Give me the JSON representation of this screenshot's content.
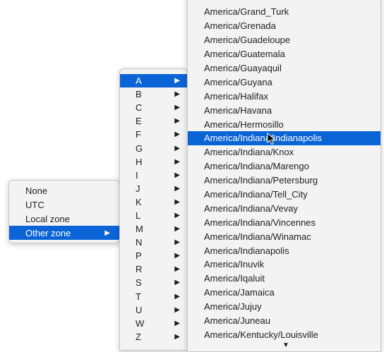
{
  "menu1": {
    "items": [
      "None",
      "UTC",
      "Local zone",
      "Other zone"
    ],
    "selected": "Other zone"
  },
  "menu2": {
    "letters": [
      "A",
      "B",
      "C",
      "E",
      "F",
      "G",
      "H",
      "I",
      "J",
      "K",
      "L",
      "M",
      "N",
      "P",
      "R",
      "S",
      "T",
      "U",
      "W",
      "Z"
    ],
    "selected": "A"
  },
  "menu3": {
    "zones": [
      "America/Grand_Turk",
      "America/Grenada",
      "America/Guadeloupe",
      "America/Guatemala",
      "America/Guayaquil",
      "America/Guyana",
      "America/Halifax",
      "America/Havana",
      "America/Hermosillo",
      "America/Indiana/Indianapolis",
      "America/Indiana/Knox",
      "America/Indiana/Marengo",
      "America/Indiana/Petersburg",
      "America/Indiana/Tell_City",
      "America/Indiana/Vevay",
      "America/Indiana/Vincennes",
      "America/Indiana/Winamac",
      "America/Indianapolis",
      "America/Inuvik",
      "America/Iqaluit",
      "America/Jamaica",
      "America/Jujuy",
      "America/Juneau",
      "America/Kentucky/Louisville"
    ],
    "selected": "America/Indiana/Indianapolis"
  },
  "icons": {
    "submenu": "chevron-right-icon",
    "scroll": "scroll-down-arrow-icon",
    "pointer": "mouse-pointer-icon"
  },
  "colors": {
    "highlight": "#0a64d6",
    "menu_bg": "#f3f3f3"
  }
}
